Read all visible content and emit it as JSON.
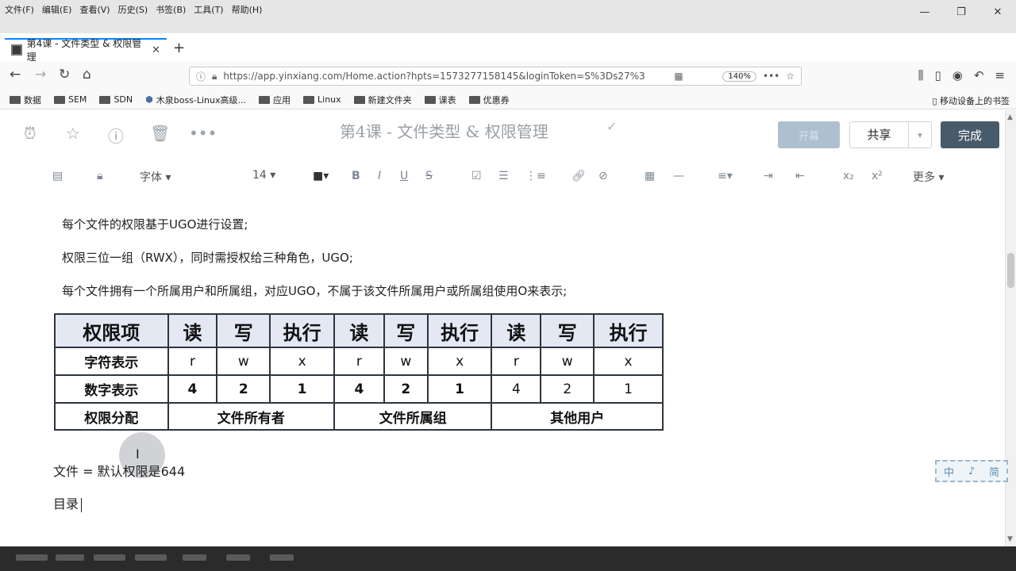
{
  "browser": {
    "menus": [
      "文件(F)",
      "编辑(E)",
      "查看(V)",
      "历史(S)",
      "书签(B)",
      "工具(T)",
      "帮助(H)"
    ],
    "window_controls": [
      "—",
      "❐",
      "✕"
    ],
    "tab_title": "第4课 - 文件类型 & 权限管理",
    "tab_close": "✕",
    "new_tab": "+",
    "url": "https://app.yinxiang.com/Home.action?hpts=1573277158145&loginToken=S%3Ds27%3",
    "zoom": "140%",
    "bookmarks": [
      "数据",
      "SEM",
      "SDN",
      "木泉boss-Linux高级...",
      "应用",
      "Linux",
      "新建文件夹",
      "课表",
      "优惠券"
    ],
    "mobile_bookmarks": "移动设备上的书签"
  },
  "editor": {
    "title": "第4课 - 文件类型 & 权限管理",
    "share_ghost_label": "开幕",
    "share_label": "共享",
    "done_label": "完成",
    "font_label": "字体",
    "font_size": "14",
    "more_label": "更多"
  },
  "content": {
    "para1": "每个文件的权限基于UGO进行设置;",
    "para2": "权限三位一组（RWX），同时需授权给三种角色，UGO;",
    "para3": "每个文件拥有一个所属用户和所属组，对应UGO，不属于该文件所属用户或所属组使用O来表示;",
    "table": {
      "header": [
        "权限项",
        "读",
        "写",
        "执行",
        "读",
        "写",
        "执行",
        "读",
        "写",
        "执行"
      ],
      "char_row": [
        "字符表示",
        "r",
        "w",
        "x",
        "r",
        "w",
        "x",
        "r",
        "w",
        "x"
      ],
      "num_row": [
        "数字表示",
        "4",
        "2",
        "1",
        "4",
        "2",
        "1",
        "4",
        "2",
        "1"
      ],
      "alloc_row": [
        "权限分配",
        "文件所有者",
        "文件所属组",
        "其他用户"
      ]
    },
    "line_file": "文件 = 默认权限是644",
    "line_toc": "目录"
  },
  "ime": [
    "中",
    "♪",
    "简"
  ]
}
